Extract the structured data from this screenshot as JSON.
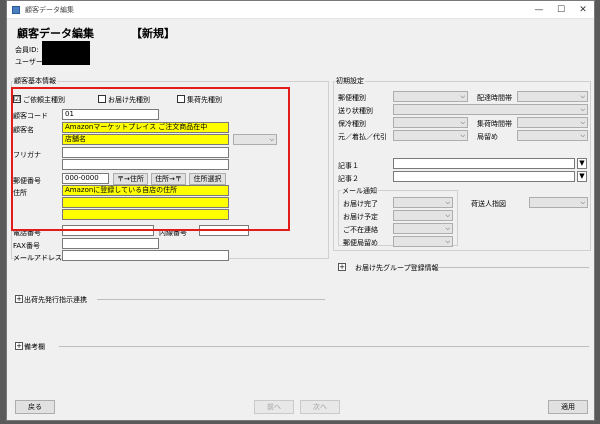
{
  "window": {
    "title": "顧客データ編集",
    "controls": {
      "minimize": "—",
      "maximize": "☐",
      "close": "✕"
    }
  },
  "header": {
    "title": "顧客データ編集",
    "mode": "【新規】"
  },
  "member": {
    "id_label": "会員ID:",
    "user_label": "ユーザー:"
  },
  "basic": {
    "group_title": "顧客基本情報",
    "checkboxes": [
      {
        "label": "ご依頼主種別",
        "checked": "☑"
      },
      {
        "label": "お届け先種別",
        "checked": ""
      },
      {
        "label": "集荷先種別",
        "checked": ""
      }
    ],
    "customer_code": {
      "label": "顧客コード",
      "value": "01"
    },
    "customer_name": {
      "label": "顧客名",
      "value1": "Amazonマーケットプレイス ご注文商品在中",
      "value2": "店舗名"
    },
    "furigana": {
      "label": "フリガナ"
    },
    "postal": {
      "label": "郵便番号",
      "value": "000-0000",
      "btn_zip_to_addr": "〒→住所",
      "btn_addr_to_zip": "住所→〒",
      "btn_addr_select": "住所選択"
    },
    "address": {
      "label": "住所",
      "value": "Amazonに登録している自店の住所"
    },
    "phone": {
      "label": "電話番号",
      "ext_label": "内線番号"
    },
    "fax": {
      "label": "FAX番号"
    },
    "email": {
      "label": "メールアドレス"
    }
  },
  "defaults": {
    "group_title": "初期設定",
    "mail_type": "郵便種別",
    "delivery_time": "配達時間帯",
    "slip_type": "送り状種別",
    "storage_type": "保冷種別",
    "pickup_time": "集荷時間帯",
    "payment": "元／着払／代引",
    "office_stop": "局留め",
    "note1": "記事１",
    "note2": "記事２",
    "mail_notice": {
      "title": "メール通知",
      "delivered": "お届け完了",
      "scheduled": "お届け予定",
      "absent": "ご不在連絡",
      "office_stop": "郵便局留め"
    },
    "cargo_instruction": "荷送人指図"
  },
  "group_delivery": "お届け先グループ登録情報",
  "shipping_link": "出荷先発行指示連携",
  "remarks": "備考欄",
  "footer": {
    "back": "戻る",
    "prev": "前へ",
    "next": "次へ",
    "apply": "適用"
  }
}
